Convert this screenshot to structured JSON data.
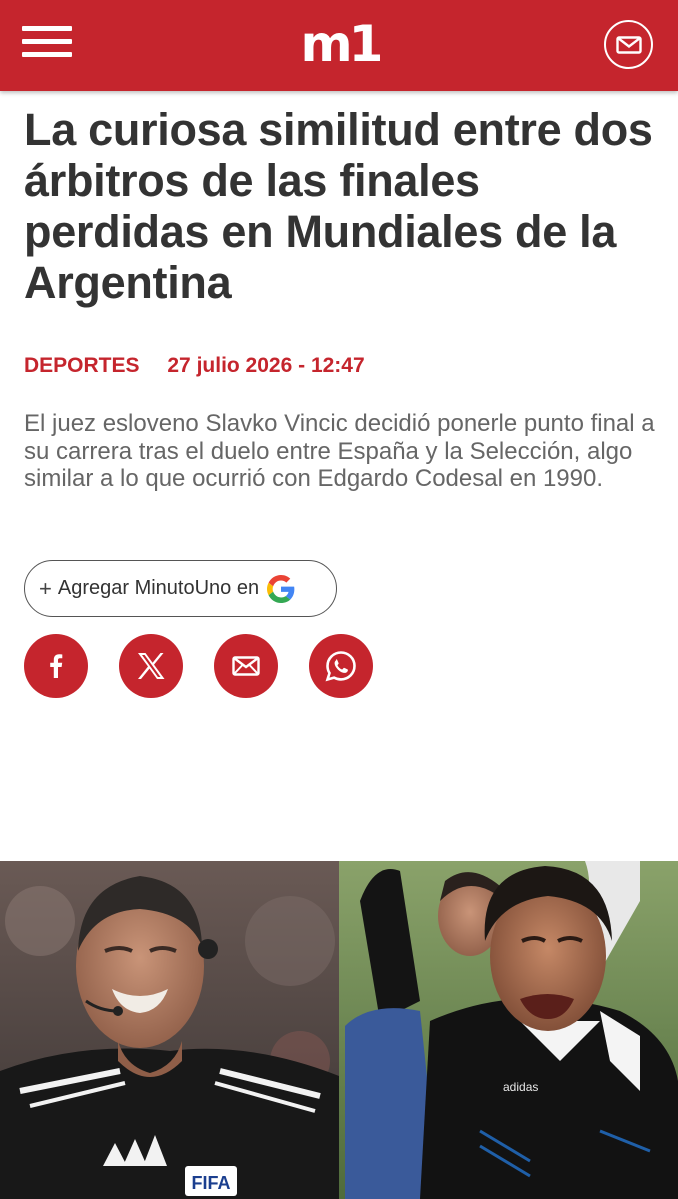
{
  "header": {
    "logo_text": "m1",
    "menu_icon": "hamburger-menu-icon",
    "mail_icon": "envelope-icon",
    "brand_color": "#c5252d"
  },
  "article": {
    "title": "La curiosa similitud entre dos árbitros de las finales perdidas en Mundiales de la Argentina",
    "section": "DEPORTES",
    "date": "27 julio 2026 - 12:47",
    "summary": "El juez esloveno Slavko Vincic decidió ponerle punto final a su carrera tras el duelo entre España y la Selección, algo similar a lo que ocurrió con Edgardo Codesal en 1990."
  },
  "google_button": {
    "plus": "+",
    "label": "Agregar MinutoUno en",
    "icon": "google-g-icon"
  },
  "share_buttons": [
    {
      "icon": "facebook-icon"
    },
    {
      "icon": "x-twitter-icon"
    },
    {
      "icon": "envelope-icon"
    },
    {
      "icon": "whatsapp-icon"
    }
  ],
  "hero_image": {
    "caption_visible": false,
    "kit_badge": "FIFA"
  }
}
